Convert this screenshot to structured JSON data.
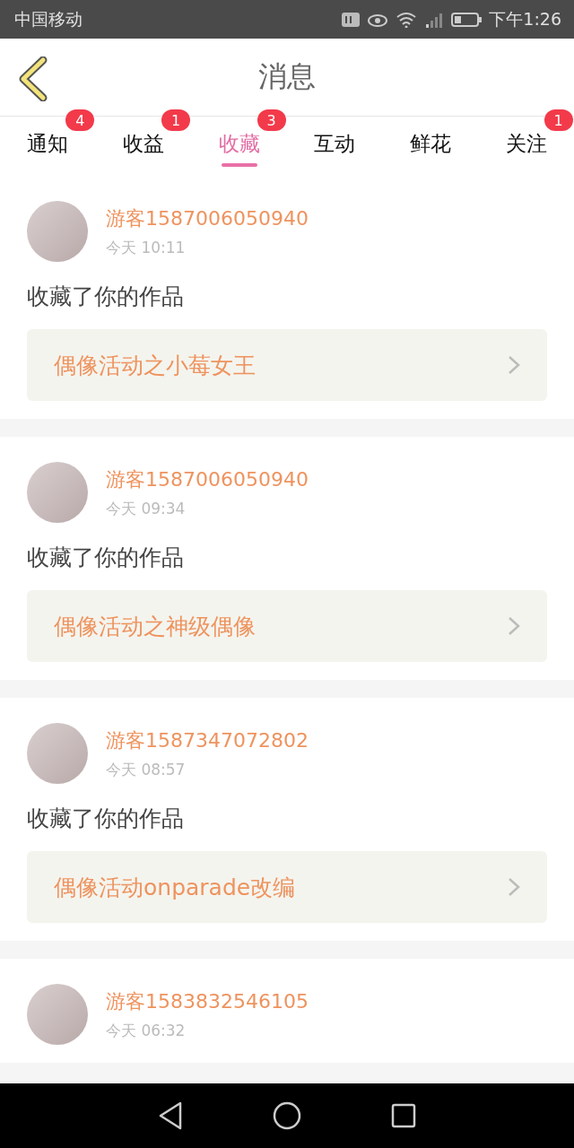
{
  "status_bar": {
    "carrier": "中国移动",
    "time": "下午1:26"
  },
  "header": {
    "title": "消息"
  },
  "tabs": [
    {
      "label": "通知",
      "badge": "4",
      "selected": false
    },
    {
      "label": "收益",
      "badge": "1",
      "selected": false
    },
    {
      "label": "收藏",
      "badge": "3",
      "selected": true
    },
    {
      "label": "互动",
      "selected": false
    },
    {
      "label": "鲜花",
      "selected": false
    },
    {
      "label": "关注",
      "badge": "1",
      "selected": false
    }
  ],
  "messages": [
    {
      "user": "游客1587006050940",
      "time": "今天 10:11",
      "action": "收藏了你的作品",
      "work": "偶像活动之小莓女王"
    },
    {
      "user": "游客1587006050940",
      "time": "今天 09:34",
      "action": "收藏了你的作品",
      "work": "偶像活动之神级偶像"
    },
    {
      "user": "游客1587347072802",
      "time": "今天 08:57",
      "action": "收藏了你的作品",
      "work": "偶像活动onparade改编"
    },
    {
      "user": "游客1583832546105",
      "time": "今天 06:32"
    }
  ]
}
